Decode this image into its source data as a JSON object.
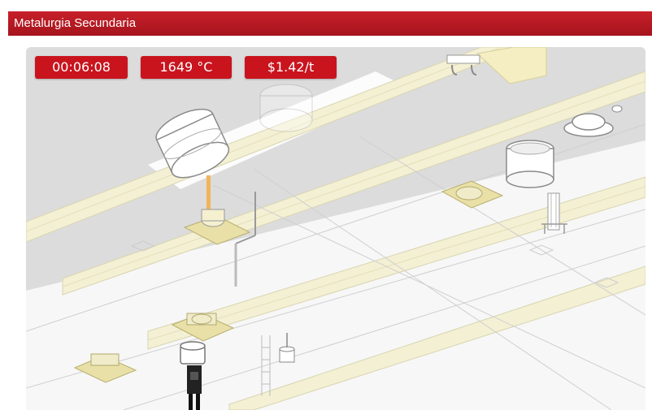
{
  "window": {
    "title": "Metalurgia Secundaria"
  },
  "hud": {
    "timer": "00:06:08",
    "temperature": "1649 °C",
    "cost": "$1.42/t"
  },
  "colors": {
    "title_bar": "#b5161f",
    "hud_badge": "#c9141e",
    "floor": "#f2f2f2",
    "rail": "#f3f0d4",
    "ladle_car": "#e8e0a6"
  },
  "icons": {
    "converter": "tilted-converter-vessel",
    "ladle_car": "ladle-transfer-car",
    "crane_hook": "overhead-crane-hook",
    "stirring_station": "argon-stirring-lance",
    "ladle_furnace": "ladle-furnace-electrodes",
    "vacuum_vessel": "vacuum-degasser-vessel",
    "lid": "ladle-lid"
  }
}
